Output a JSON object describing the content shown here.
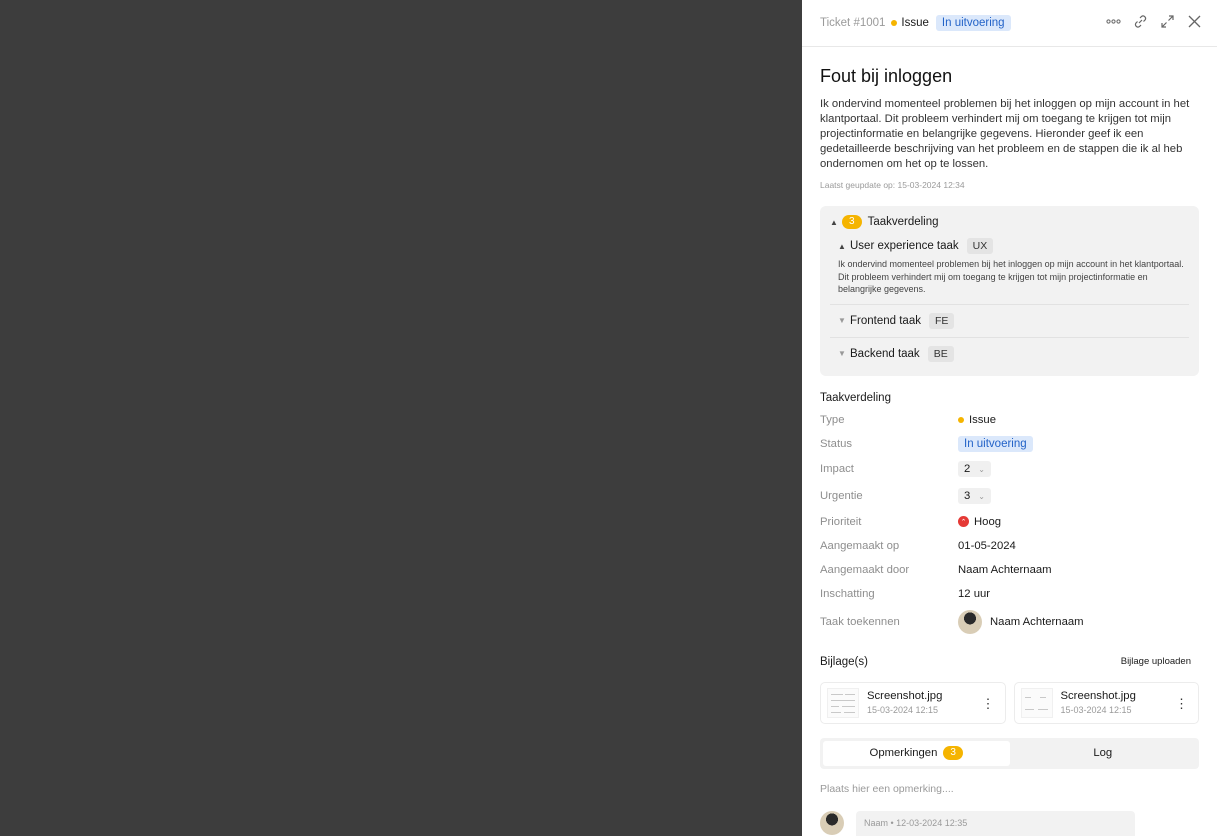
{
  "header": {
    "ticket_id": "Ticket #1001",
    "type": "Issue",
    "status": "In uitvoering"
  },
  "ticket": {
    "title": "Fout bij inloggen",
    "description": "Ik ondervind momenteel problemen bij het inloggen op mijn account in het klantportaal. Dit probleem verhindert mij om toegang te krijgen tot mijn projectinformatie en belangrijke gegevens. Hieronder geef ik een gedetailleerde beschrijving van het probleem en de stappen die ik al heb ondernomen om het op te lossen.",
    "updated": "Laatst geupdate op: 15-03-2024 12:34"
  },
  "tasks": {
    "count": "3",
    "title": "Taakverdeling",
    "items": [
      {
        "name": "User experience taak",
        "tag": "UX",
        "description": "Ik ondervind momenteel problemen bij het inloggen op mijn account in het klantportaal. Dit probleem verhindert mij om toegang te krijgen tot mijn projectinformatie en belangrijke gegevens."
      },
      {
        "name": "Frontend taak",
        "tag": "FE"
      },
      {
        "name": "Backend taak",
        "tag": "BE"
      }
    ]
  },
  "details": {
    "title": "Taakverdeling",
    "type_label": "Type",
    "type_value": "Issue",
    "status_label": "Status",
    "status_value": "In uitvoering",
    "impact_label": "Impact",
    "impact_value": "2",
    "urgency_label": "Urgentie",
    "urgency_value": "3",
    "priority_label": "Prioriteit",
    "priority_value": "Hoog",
    "created_label": "Aangemaakt op",
    "created_value": "01-05-2024",
    "created_by_label": "Aangemaakt door",
    "created_by_value": "Naam Achternaam",
    "estimate_label": "Inschatting",
    "estimate_value": "12 uur",
    "assign_label": "Taak toekennen",
    "assign_value": "Naam Achternaam"
  },
  "attachments": {
    "title": "Bijlage(s)",
    "upload_label": "Bijlage uploaden",
    "files": [
      {
        "name": "Screenshot.jpg",
        "date": "15-03-2024 12:15"
      },
      {
        "name": "Screenshot.jpg",
        "date": "15-03-2024 12:15"
      }
    ]
  },
  "tabs": {
    "comments_label": "Opmerkingen",
    "comments_count": "3",
    "log_label": "Log"
  },
  "comments": {
    "placeholder": "Plaats hier een opmerking....",
    "first_meta": "Naam • 12-03-2024 12:35"
  },
  "colors": {
    "accent_yellow": "#f5b400",
    "status_blue_bg": "#dbe8fb",
    "status_blue_text": "#2363c8",
    "priority_red": "#e53935",
    "backdrop": "#3d3d3d"
  }
}
